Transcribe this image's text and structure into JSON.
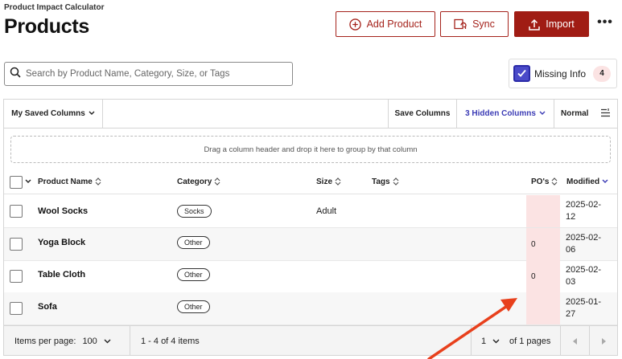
{
  "app": {
    "subtitle": "Product Impact Calculator",
    "title": "Products"
  },
  "actions": {
    "add_label": "Add Product",
    "sync_label": "Sync",
    "import_label": "Import",
    "more_label": "•••"
  },
  "search": {
    "placeholder": "Search by Product Name, Category, Size, or Tags",
    "value": ""
  },
  "missing_info": {
    "label": "Missing Info",
    "count": "4",
    "checked": true
  },
  "toolbar": {
    "saved_columns": "My Saved Columns",
    "save_columns": "Save Columns",
    "hidden_columns": "3 Hidden Columns",
    "density": "Normal"
  },
  "group_zone": "Drag a column header and drop it here to group by that column",
  "columns": {
    "name": "Product Name",
    "category": "Category",
    "size": "Size",
    "tags": "Tags",
    "pos": "PO's",
    "modified": "Modified"
  },
  "rows": [
    {
      "name": "Wool Socks",
      "category": "Socks",
      "size": "Adult",
      "tags": "",
      "pos": "",
      "modified": "2025-02-12"
    },
    {
      "name": "Yoga Block",
      "category": "Other",
      "size": "",
      "tags": "",
      "pos": "0",
      "modified": "2025-02-06"
    },
    {
      "name": "Table Cloth",
      "category": "Other",
      "size": "",
      "tags": "",
      "pos": "0",
      "modified": "2025-02-03"
    },
    {
      "name": "Sofa",
      "category": "Other",
      "size": "",
      "tags": "",
      "pos": "",
      "modified": "2025-01-27"
    }
  ],
  "footer": {
    "per_page_label": "Items per page:",
    "per_page_value": "100",
    "range": "1 - 4 of 4 items",
    "page": "1",
    "of_pages": "of 1 pages"
  },
  "colors": {
    "brand": "#a01c14",
    "highlight": "#fbe3e3",
    "accent_blue": "#3b3bb5",
    "annotation_arrow": "#e8401c"
  }
}
